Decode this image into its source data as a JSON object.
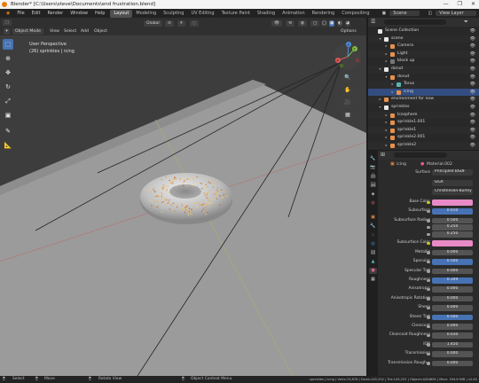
{
  "window": {
    "title": "Blender* [C:\\Users\\steve\\Documents\\end frustration.blend]",
    "controls": [
      "—",
      "❐",
      "✕"
    ]
  },
  "menubar": {
    "menus": [
      "File",
      "Edit",
      "Render",
      "Window",
      "Help"
    ],
    "workspaces": [
      "Layout",
      "Modeling",
      "Sculpting",
      "UV Editing",
      "Texture Paint",
      "Shading",
      "Animation",
      "Rendering",
      "Compositing"
    ],
    "active_workspace": "Layout",
    "scene_label": "Scene",
    "view_layer_label": "View Layer"
  },
  "viewport_header": {
    "mode": "Object Mode",
    "view": "View",
    "select": "Select",
    "add": "Add",
    "object": "Object",
    "transform": "Global",
    "options": "Options"
  },
  "viewport": {
    "perspective": "User Perspective",
    "object_info": "(26) sprinkles | icing"
  },
  "gizmo": {
    "x": "X",
    "y": "Y",
    "z": "Z"
  },
  "outliner": {
    "rows": [
      {
        "label": "Scene Collection",
        "level": 0,
        "icon": "#e6e6e6",
        "tri": ""
      },
      {
        "label": "scene",
        "level": 1,
        "icon": "#e6e6e6",
        "tri": "▾"
      },
      {
        "label": "Camera",
        "level": 2,
        "icon": "#e8904c",
        "tri": "▸"
      },
      {
        "label": "Light",
        "level": 2,
        "icon": "#e8904c",
        "tri": "▸"
      },
      {
        "label": "block up",
        "level": 2,
        "icon": "#777777",
        "tri": "▸"
      },
      {
        "label": "donut",
        "level": 1,
        "icon": "#e6e6e6",
        "tri": "▾"
      },
      {
        "label": "donut",
        "level": 2,
        "icon": "#e8904c",
        "tri": "▾"
      },
      {
        "label": "Torus",
        "level": 3,
        "icon": "#58b6b6",
        "tri": "▸"
      },
      {
        "label": "icing",
        "level": 3,
        "icon": "#e8904c",
        "tri": "▸",
        "selected": true
      },
      {
        "label": "environment for now",
        "level": 1,
        "icon": "#e8904c",
        "tri": "▸"
      },
      {
        "label": "sprinkles",
        "level": 1,
        "icon": "#e6e6e6",
        "tri": "▾"
      },
      {
        "label": "Icosphere",
        "level": 2,
        "icon": "#e8904c",
        "tri": "▸"
      },
      {
        "label": "sprinkle1.001",
        "level": 2,
        "icon": "#e8904c",
        "tri": "▸"
      },
      {
        "label": "sprinkle1",
        "level": 2,
        "icon": "#e8904c",
        "tri": "▸"
      },
      {
        "label": "sprinkle2.001",
        "level": 2,
        "icon": "#e8904c",
        "tri": "▸"
      },
      {
        "label": "sprinkle2",
        "level": 2,
        "icon": "#e8904c",
        "tri": "▸"
      }
    ]
  },
  "properties": {
    "object_name": "icing",
    "material_name": "Material.002",
    "surface_label": "Surface",
    "surface_value": "Principled BSDF",
    "distribution": "GGX",
    "subsurface_method": "Christensen-Burley",
    "fields": [
      {
        "label": "Base Color",
        "value": "",
        "style": "pink"
      },
      {
        "label": "Subsurface",
        "value": "0.010",
        "style": "blue"
      },
      {
        "label": "Subsurface Radius",
        "value": "0.500",
        "style": "normal"
      },
      {
        "label": "",
        "value": "0.250",
        "style": "normal"
      },
      {
        "label": "",
        "value": "0.250",
        "style": "normal"
      },
      {
        "label": "Subsurface Color",
        "value": "",
        "style": "pink"
      },
      {
        "label": "Metallic",
        "value": "0.000",
        "style": "normal"
      },
      {
        "label": "Specular",
        "value": "0.500",
        "style": "blue"
      },
      {
        "label": "Specular Tint",
        "value": "0.000",
        "style": "normal"
      },
      {
        "label": "Roughness",
        "value": "0.349",
        "style": "blue"
      },
      {
        "label": "Anisotropic",
        "value": "0.000",
        "style": "normal"
      },
      {
        "label": "Anisotropic Rotation",
        "value": "0.000",
        "style": "normal"
      },
      {
        "label": "Sheen",
        "value": "0.000",
        "style": "normal"
      },
      {
        "label": "Sheen Tint",
        "value": "0.500",
        "style": "blue"
      },
      {
        "label": "Clearcoat",
        "value": "0.000",
        "style": "normal"
      },
      {
        "label": "Clearcoat Roughness",
        "value": "0.030",
        "style": "normal"
      },
      {
        "label": "IOR",
        "value": "1.450",
        "style": "normal"
      },
      {
        "label": "Transmission",
        "value": "0.000",
        "style": "normal"
      },
      {
        "label": "Transmission Rough...",
        "value": "0.000",
        "style": "normal"
      }
    ]
  },
  "statusbar": {
    "select": "Select",
    "move": "Move",
    "rotate": "Rotate View",
    "context": "Object Context Menu",
    "stats": "sprinkles | icing | Verts:74,876 | Faces:145,252 | Tris:149,252 | Objects:0/64694 | Mem: 394.6 MiB | v2.82"
  },
  "colors": {
    "accent": "#4772b3",
    "base_color": "#e88ac6",
    "selection": "#334d80",
    "viewport_bg": "#3d3d3d",
    "floor": "#9b9b9b"
  }
}
